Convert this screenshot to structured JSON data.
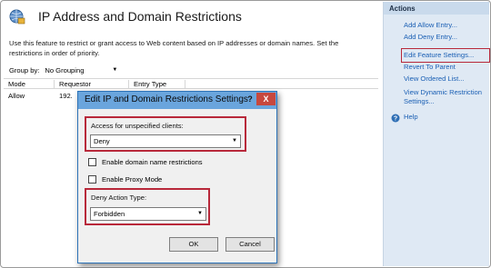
{
  "page": {
    "title": "IP Address and Domain Restrictions",
    "description": "Use this feature to restrict or grant access to Web content based on IP addresses or domain names. Set the restrictions in order of priority."
  },
  "groupby": {
    "label": "Group by:",
    "value": "No Grouping"
  },
  "grid": {
    "columns": [
      "Mode",
      "Requestor",
      "Entry Type"
    ],
    "rows": [
      {
        "mode": "Allow",
        "requestor": "192."
      }
    ]
  },
  "actions": {
    "header": "Actions",
    "items": [
      "Add Allow Entry...",
      "Add Deny Entry...",
      "Edit Feature Settings...",
      "Revert To Parent",
      "View Ordered List...",
      "View Dynamic Restriction Settings...",
      "Help"
    ],
    "highlighted_index": 2
  },
  "dialog": {
    "title": "Edit IP and Domain Restrictions Settings",
    "help_button": "?",
    "close_button": "X",
    "access_label": "Access for unspecified clients:",
    "access_value": "Deny",
    "enable_domain_label": "Enable domain name restrictions",
    "enable_proxy_label": "Enable Proxy Mode",
    "deny_action_label": "Deny Action Type:",
    "deny_action_value": "Forbidden",
    "ok_label": "OK",
    "cancel_label": "Cancel"
  },
  "colors": {
    "highlight_box": "#b8283a",
    "actions_panel_bg": "#dfe9f4",
    "dialog_titlebar": "#6aa5dd",
    "link": "#1a5fb4"
  }
}
